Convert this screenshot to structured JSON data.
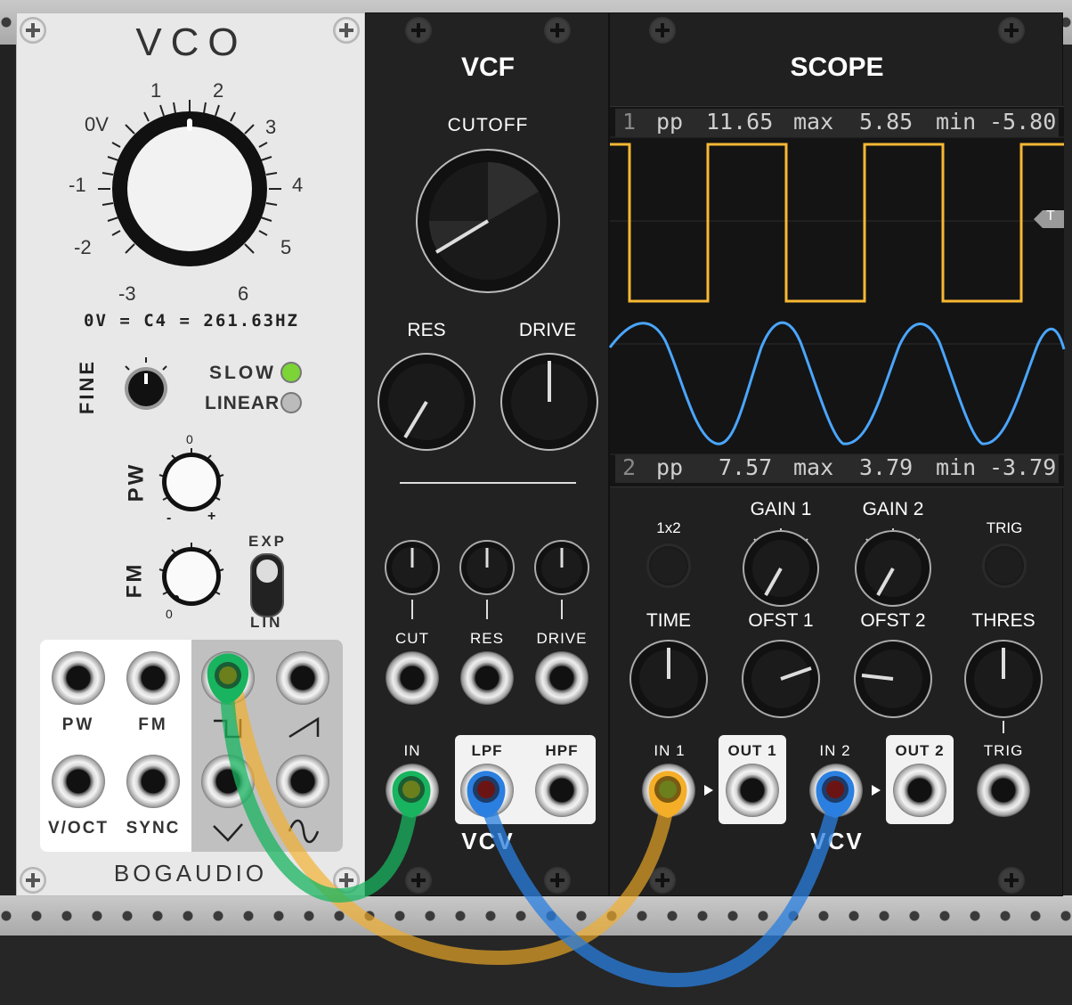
{
  "vco": {
    "title": "VCO",
    "freq_scale": [
      "-3",
      "-2",
      "-1",
      "0V",
      "1",
      "2",
      "3",
      "4",
      "5",
      "6"
    ],
    "freq_note": "0V = C4 = 261.63HZ",
    "fine_label": "FINE",
    "slow_label": "SLOW",
    "linear_label": "LINEAR",
    "slow_led_on": true,
    "linear_led_on": false,
    "pw_label": "PW",
    "pw_zero": "0",
    "pw_minus": "-",
    "pw_plus": "+",
    "fm_label": "FM",
    "fm_zero": "0",
    "exp_label": "EXP",
    "lin_label": "LIN",
    "jack_pw": "PW",
    "jack_fm": "FM",
    "jack_voct": "V/OCT",
    "jack_sync": "SYNC",
    "brand": "BOGAUDIO"
  },
  "vcf": {
    "title": "VCF",
    "cutoff_label": "CUTOFF",
    "res_label": "RES",
    "drive_label": "DRIVE",
    "cv_cut_label": "CUT",
    "cv_res_label": "RES",
    "cv_drive_label": "DRIVE",
    "in_label": "IN",
    "lpf_label": "LPF",
    "hpf_label": "HPF",
    "brand": "VCV"
  },
  "scope": {
    "title": "SCOPE",
    "ch1": {
      "num": "1",
      "pp_label": "pp",
      "pp": "11.65",
      "max_label": "max",
      "max": "5.85",
      "min_label": "min",
      "min": "-5.80"
    },
    "ch2": {
      "num": "2",
      "pp_label": "pp",
      "pp": "7.57",
      "max_label": "max",
      "max": "3.79",
      "min_label": "min",
      "min": "-3.79"
    },
    "trigger_marker": "T",
    "x2_label": "1x2",
    "gain1_label": "GAIN 1",
    "gain2_label": "GAIN 2",
    "trig_label": "TRIG",
    "time_label": "TIME",
    "ofst1_label": "OFST 1",
    "ofst2_label": "OFST 2",
    "thres_label": "THRES",
    "in1_label": "IN 1",
    "out1_label": "OUT 1",
    "in2_label": "IN 2",
    "out2_label": "OUT 2",
    "trig_in_label": "TRIG",
    "brand": "VCV"
  },
  "colors": {
    "cable_green": "#18b45f",
    "cable_yellow": "#f5ae27",
    "cable_blue": "#2a7fe0",
    "trace_ch1": "#f8b833",
    "trace_ch2": "#4aa6ff",
    "led_green": "#7cd437"
  },
  "icons": {
    "square_wave": "square-wave-icon",
    "saw_wave": "saw-wave-icon",
    "triangle_wave": "triangle-wave-icon",
    "sine_wave": "sine-wave-icon"
  }
}
